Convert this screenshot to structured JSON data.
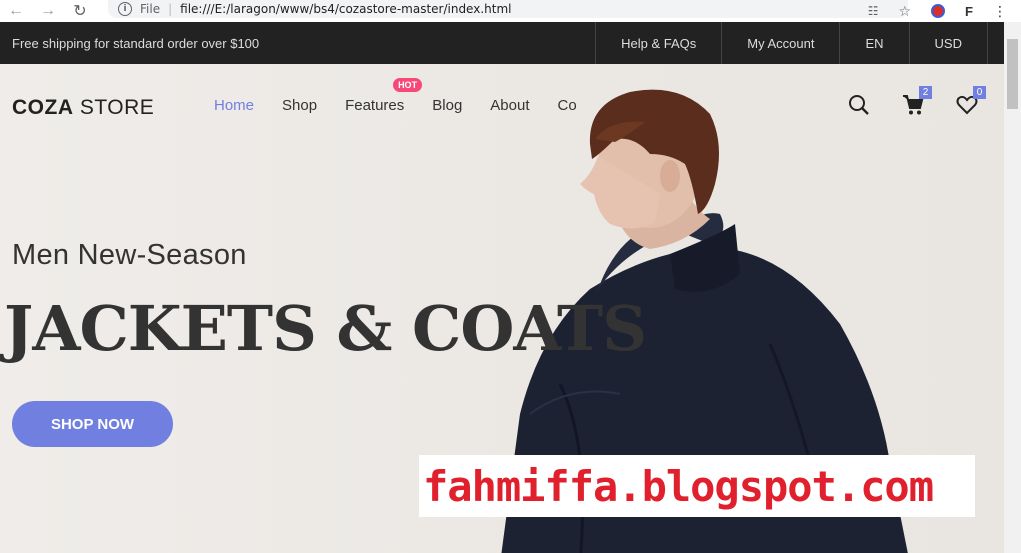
{
  "browser": {
    "scheme": "File",
    "url": "file:///E:/laragon/www/bs4/cozastore-master/index.html"
  },
  "topbar": {
    "shipping": "Free shipping for standard order over $100",
    "links": [
      "Help & FAQs",
      "My Account",
      "EN",
      "USD"
    ]
  },
  "header": {
    "logo_bold": "COZA",
    "logo_light": " STORE",
    "menu": [
      "Home",
      "Shop",
      "Features",
      "Blog",
      "About",
      "Co"
    ],
    "hot_badge": "HOT",
    "cart_count": "2",
    "wishlist_count": "0"
  },
  "hero": {
    "subtitle": "Men New-Season",
    "headline": "JACKETS & COATS",
    "button": "SHOP NOW"
  },
  "watermark": "fahmiffa.blogspot.com",
  "colors": {
    "accent": "#717fe0",
    "hot": "#f74877",
    "topbar": "#222222",
    "watermark": "#e0202d"
  }
}
